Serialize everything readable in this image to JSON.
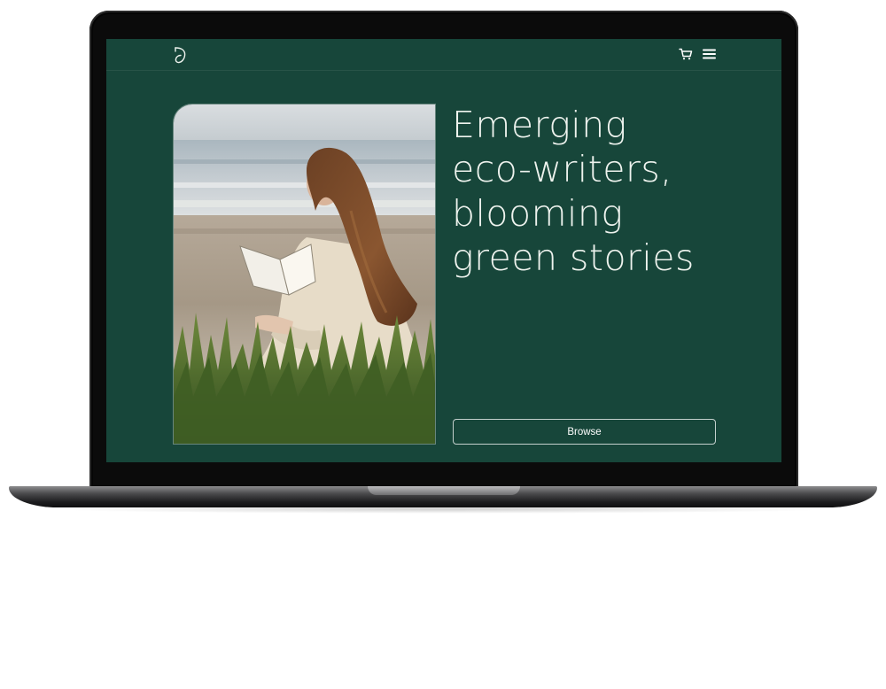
{
  "page": {
    "colors": {
      "screen_background": "#17463a",
      "text": "#eef3ee",
      "button_border": "#ffffff",
      "laptop_frame": "#0b0b0b"
    }
  },
  "header": {
    "logo_icon": "leaf-b-logo-icon",
    "cart_icon": "shopping-cart-icon",
    "menu_icon": "hamburger-menu-icon"
  },
  "hero": {
    "headline_lines": [
      "Emerging",
      "eco-writers,",
      "blooming",
      "green stories"
    ],
    "image_description_icon": "woman-reading-book-on-beach-photo",
    "cta_label": "Browse"
  }
}
